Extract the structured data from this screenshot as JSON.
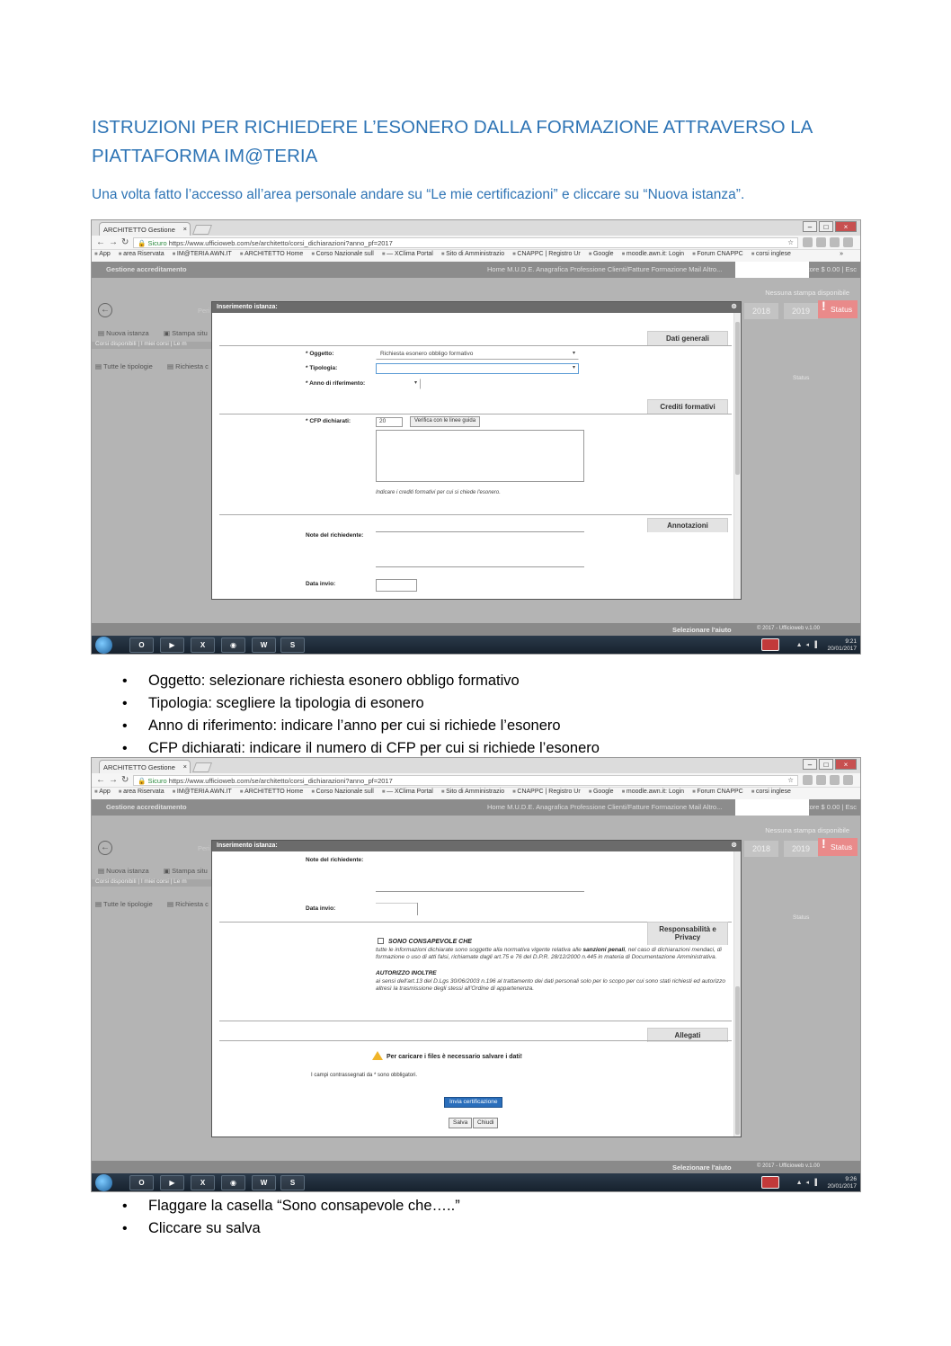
{
  "title": "ISTRUZIONI PER RICHIEDERE L’ESONERO DALLA FORMAZIONE ATTRAVERSO LA PIATTAFORMA IM@TERIA",
  "intro": "Una volta fatto l’accesso all’area personale andare su “Le mie certificazioni” e cliccare su “Nuova istanza”.",
  "bullets_1": [
    "Oggetto: selezionare richiesta esonero obbligo formativo",
    "Tipologia: scegliere la tipologia di esonero",
    "Anno di riferimento: indicare l’anno per cui si richiede l’esonero",
    "CFP dichiarati: indicare il numero di CFP per cui si richiede l’esonero"
  ],
  "bullets_2": [
    "Flaggare la casella “Sono consapevole che…..”",
    "Cliccare su salva"
  ],
  "browser": {
    "tab_title": "ARCHITETTO Gestione",
    "url_secure": "Sicuro",
    "url_1": "https://www.ufficioweb.com/se/architetto/corsi_dichiarazioni?anno_pf=2017",
    "url_2": "https://www.ufficioweb.com/se/architetto/corsi_dichiarazioni?anno_pf=2017",
    "bookmarks": [
      "App",
      "area Riservata",
      "IM@TERIA AWN.IT",
      "ARCHITETTO Home",
      "Corso Nazionale sull",
      "— XClima Portal",
      "Sito di Amministrazio",
      "CNAPPC | Registro Ur",
      "Google",
      "moodle.awn.it: Login",
      "Forum CNAPPC",
      "corsi inglese"
    ],
    "bookmarks_more": "»"
  },
  "app": {
    "header": "Gestione accreditamento",
    "menu": "Home   M.U.D.E.   Anagrafica   Professione   Clienti/Fatture   Formazione   Mail   Altro...",
    "store": "Store $ 0.00  |  Esc",
    "no_print": "Nessuna stampa disponibile",
    "years": [
      "2018",
      "2019"
    ],
    "status_btn": "Status",
    "period_label": "Peri",
    "new_request": "Nuova istanza",
    "print_label": "Stampa situ",
    "available_courses": "Corsi disponibili | I miei corsi | Le m",
    "all_types": "Tutte le tipologie",
    "request_label": "Richiesta c",
    "status_col": "Status",
    "help": "Selezionare l'aiuto",
    "copyright": "© 2017 - Ufficioweb v.1.00"
  },
  "modal": {
    "header": "Inserimento istanza:",
    "close": "⊗",
    "sections": {
      "general": "Dati generali",
      "credits": "Crediti formativi",
      "notes": "Annotazioni",
      "responsibility": "Responsabilità e Privacy",
      "attachments": "Allegati"
    },
    "fields": {
      "oggetto_label": "* Oggetto:",
      "oggetto_value": "Richiesta esonero obbligo formativo",
      "tipologia_label": "* Tipologia:",
      "tipologia_value": "",
      "anno_label": "* Anno di riferimento:",
      "anno_value": "",
      "cfp_label": "* CFP dichiarati:",
      "cfp_value": "20",
      "verifica_btn": "Verifica con le linee guida",
      "cfp_hint": "Indicare i crediti formativi per cui si chiede l'esonero.",
      "note_label": "Note del richiedente:",
      "date_label": "Data invio:"
    },
    "privacy": {
      "checkbox_label": "SONO CONSAPEVOLE CHE",
      "text_1_a": "tutte le informazioni dichiarate sono soggette alla normativa vigente relativa alle",
      "text_1_bold": "sanzioni penali",
      "text_1_b": ", nel caso di dichiarazioni mendaci, di formazione o uso di atti falsi, richiamate dagli art.75 e 76 del D.P.R. 28/12/2000 n.445 in materia di Documentazione Amministrativa.",
      "authorize": "AUTORIZZO INOLTRE",
      "text_2": "ai sensi dell'art.13 del D.Lgs 30/06/2003 n.196 al trattamento dei dati personali solo per lo scopo per cui sono stati richiesti ed autorizzo altresì la trasmissione degli stessi all'Ordine di appartenenza."
    },
    "upload_warning": "Per caricare i files è necessario salvare i dati!",
    "required_note": "I campi contrassegnati da * sono obbligatori.",
    "send_btn": "Invia certificazione",
    "save_btn": "Salva",
    "close_btn": "Chiudi"
  },
  "taskbar": {
    "time_1": "9:21",
    "date_1": "20/01/2017",
    "time_2": "9:26",
    "date_2": "20/01/2017"
  }
}
